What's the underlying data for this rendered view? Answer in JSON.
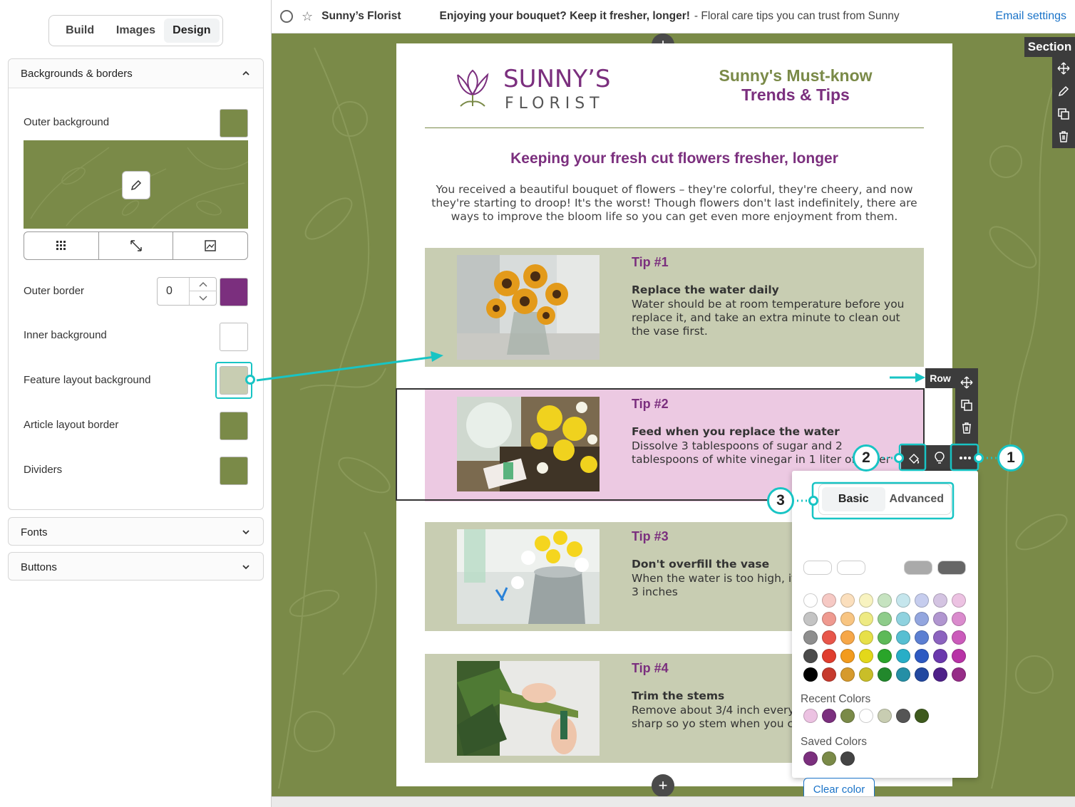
{
  "tabs": [
    {
      "label": "Build",
      "active": false
    },
    {
      "label": "Images",
      "active": false
    },
    {
      "label": "Design",
      "active": true
    }
  ],
  "panel": {
    "title": "Backgrounds & borders",
    "outer_background": {
      "label": "Outer background",
      "color": "#7a8a48"
    },
    "outer_border": {
      "label": "Outer border",
      "value": "0",
      "color": "#7b2f7e"
    },
    "inner_background": {
      "label": "Inner background",
      "color": "#ffffff"
    },
    "feature_layout_background": {
      "label": "Feature layout background",
      "color": "#c8cdb2"
    },
    "article_layout_border": {
      "label": "Article layout border",
      "color": "#7a8a48"
    },
    "dividers": {
      "label": "Dividers",
      "color": "#7a8a48"
    },
    "tile_icons": [
      "grid-icon",
      "expand-icon",
      "image-fit-icon"
    ]
  },
  "sections": [
    {
      "label": "Fonts"
    },
    {
      "label": "Buttons"
    }
  ],
  "topbar": {
    "name": "Sunny’s Florist",
    "subject": "Enjoying your bouquet? Keep it fresher, longer!",
    "preheader": "- Floral care tips you can trust from Sunny",
    "email_settings": "Email settings"
  },
  "email": {
    "logo_top": "SUNNY’S",
    "logo_bottom": "FLORIST",
    "headline_line1": "Sunny's Must-know",
    "headline_line2": "Trends & Tips",
    "title": "Keeping your fresh cut flowers fresher, longer",
    "intro": "You received a beautiful bouquet of flowers – they're colorful, they're cheery, and now they're starting to droop! It's the worst! Though flowers don't last indefinitely, there are ways to improve the bloom life so you can get even more enjoyment from them.",
    "tips": [
      {
        "title": "Tip #1",
        "heading": "Replace the water daily",
        "body": "Water should be at room temperature before you replace it, and take an extra minute to clean out the vase first."
      },
      {
        "title": "Tip #2",
        "heading": "Feed when you replace the water",
        "body": "Dissolve 3 tablespoons of sugar and 2 tablespoons of white vinegar in 1 liter of water"
      },
      {
        "title": "Tip #3",
        "heading": "Don't overfill the vase",
        "body": "When the water is too high, it Only fill the vase 1-3 inches"
      },
      {
        "title": "Tip #4",
        "heading": "Trim the stems",
        "body": "Remove about 3/4 inch every sure your knife is sharp so yo stem when you cut."
      }
    ]
  },
  "toolbars": {
    "section_label": "Section",
    "row_label": "Row"
  },
  "picker": {
    "tabs": [
      "Basic",
      "Advanced"
    ],
    "recent_label": "Recent Colors",
    "saved_label": "Saved Colors",
    "clear_label": "Clear color",
    "top_pills": [
      "#ffffff",
      "#ffffff",
      "#ffffff",
      "#aaaaaa",
      "#666666"
    ],
    "grid": [
      [
        "#ffffff",
        "#f6c9c4",
        "#fbdfbd",
        "#f8f3c0",
        "#c6e3c0",
        "#c5e6ed",
        "#c6cdee",
        "#d4c4e2",
        "#ecc2e2"
      ],
      [
        "#c4c4c4",
        "#ef9a90",
        "#f8c582",
        "#eeea83",
        "#8ecc8a",
        "#8fd2df",
        "#93a6df",
        "#b196d0",
        "#da8bcd"
      ],
      [
        "#8e8e8e",
        "#e8564a",
        "#f6a748",
        "#e7e049",
        "#5db958",
        "#57bfd2",
        "#5c7fd2",
        "#8c63bf",
        "#cb5bbb"
      ],
      [
        "#4b4b4b",
        "#e03d2e",
        "#f29b1d",
        "#e3d81a",
        "#2aa52a",
        "#28aec7",
        "#2d59c2",
        "#6b38ad",
        "#b833a6"
      ],
      [
        "#000000",
        "#c63a2d",
        "#d69a2c",
        "#c9be28",
        "#22882c",
        "#258fa6",
        "#2248a0",
        "#4e2089",
        "#962c87"
      ]
    ],
    "recent": [
      "#ecc2e2",
      "#7b2f7e",
      "#7a8a48",
      "#ffffff",
      "#c8cdb2",
      "#555555",
      "#3e5a1d"
    ],
    "saved": [
      "#7b2f7e",
      "#7a8a48",
      "#444444"
    ]
  },
  "callouts": [
    "1",
    "2",
    "3"
  ]
}
